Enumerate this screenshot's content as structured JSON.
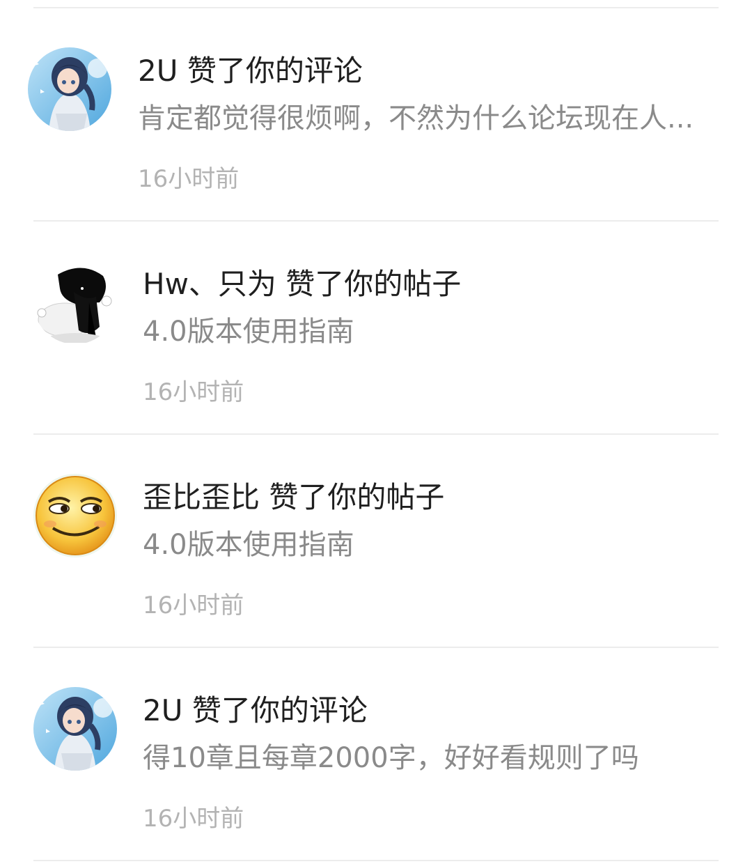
{
  "notifications": [
    {
      "avatar_icon": "anime-girl-avatar-icon",
      "title": "2U 赞了你的评论",
      "snippet": "肯定都觉得很烦啊，不然为什么论坛现在人...",
      "time": "16小时前"
    },
    {
      "avatar_icon": "black-white-boy-avatar-icon",
      "title": "Hw、只为 赞了你的帖子",
      "snippet": "4.0版本使用指南",
      "time": "16小时前"
    },
    {
      "avatar_icon": "smirk-emoji-avatar-icon",
      "title": "歪比歪比 赞了你的帖子",
      "snippet": "4.0版本使用指南",
      "time": "16小时前"
    },
    {
      "avatar_icon": "anime-girl-avatar-icon",
      "title": "2U 赞了你的评论",
      "snippet": "得10章且每章2000字，好好看规则了吗",
      "time": "16小时前"
    }
  ]
}
